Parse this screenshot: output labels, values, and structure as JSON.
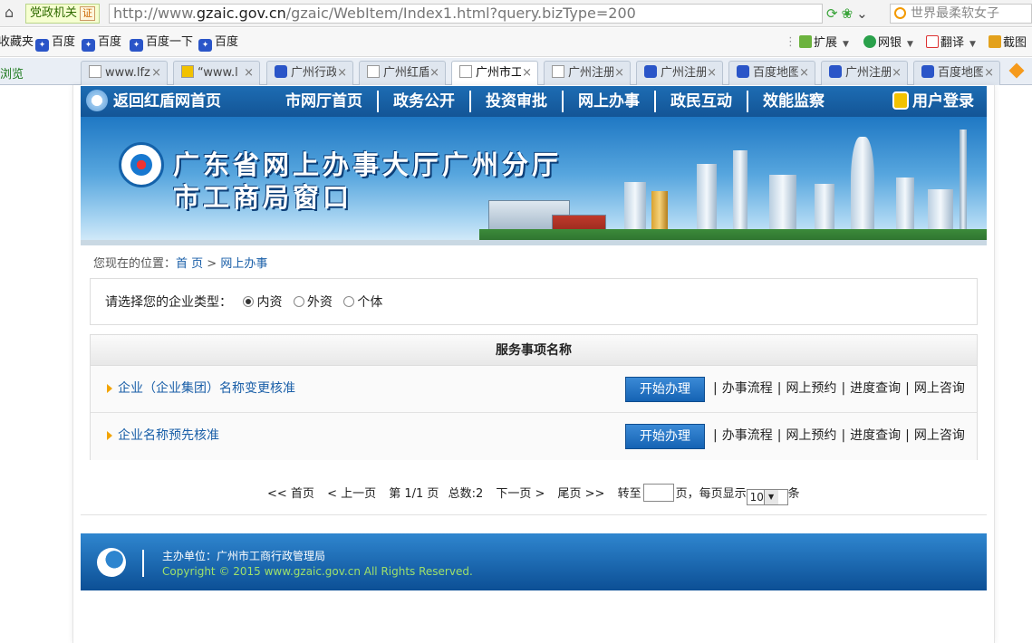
{
  "browser": {
    "site_tag": "党政机关",
    "cert_badge": "证",
    "url_prefix": "http://www.",
    "url_host": "gzaic.gov.cn",
    "url_path": "/gzaic/WebItem/Index1.html?query.bizType=200",
    "search_text": "世界最柔软女子",
    "favorites": [
      "收藏夹",
      "百度",
      "百度",
      "百度一下",
      "百度"
    ],
    "tools": [
      "扩展",
      "网银",
      "翻译",
      "截图"
    ],
    "tab_side_label": "浏览",
    "tabs": [
      "www.lfz",
      "“www.l",
      "广州行政",
      "广州红盾",
      "广州市工",
      "广州注册",
      "广州注册",
      "百度地图",
      "广州注册",
      "百度地图"
    ]
  },
  "nav": {
    "home": "返回红盾网首页",
    "menu": [
      "市网厅首页",
      "政务公开",
      "投资审批",
      "网上办事",
      "政民互动",
      "效能监察"
    ],
    "login": "用户登录"
  },
  "banner": {
    "title_line1": "广东省网上办事大厅广州分厅",
    "title_line2": "市工商局窗口"
  },
  "breadcrumb": {
    "prefix": "您现在的位置：",
    "home": "首 页",
    "sep": " > ",
    "current": "网上办事"
  },
  "enterprise_type": {
    "question": "请选择您的企业类型：",
    "options": [
      "内资",
      "外资",
      "个体"
    ],
    "selected": "内资"
  },
  "services": {
    "header": "服务事项名称",
    "start_label": "开始办理",
    "actions": [
      "办事流程",
      "网上预约",
      "进度查询",
      "网上咨询"
    ],
    "items": [
      "企业（企业集团）名称变更核准",
      "企业名称预先核准"
    ]
  },
  "pager": {
    "first": "<< 首页",
    "prev": "< 上一页",
    "page_info": "第 1/1 页",
    "total": "总数:2",
    "next": "下一页 >",
    "last": "尾页 >>",
    "goto_prefix": "转至",
    "goto_suffix": "页，每页显示",
    "page_size": "10",
    "unit": "条"
  },
  "footer": {
    "org": "主办单位：广州市工商行政管理局",
    "copyright": "Copyright © 2015 www.gzaic.gov.cn All Rights Reserved."
  }
}
